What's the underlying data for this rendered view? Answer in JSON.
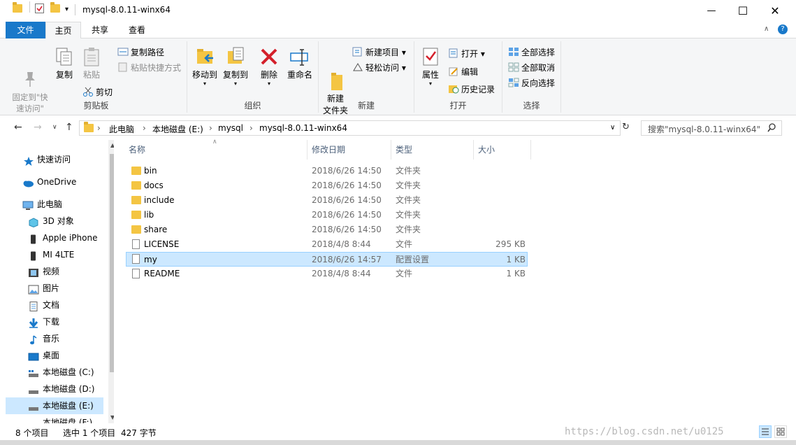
{
  "window": {
    "title": "mysql-8.0.11-winx64",
    "minimize": "—",
    "maximize": "☐",
    "close": "✕"
  },
  "ribbon_tabs": {
    "file": "文件",
    "home": "主页",
    "share": "共享",
    "view": "查看"
  },
  "ribbon": {
    "clipboard": {
      "pin": "固定到\"快\n速访问\"",
      "copy": "复制",
      "paste": "粘贴",
      "copy_path": "复制路径",
      "paste_shortcut": "粘贴快捷方式",
      "cut": "剪切",
      "label": "剪贴板"
    },
    "organize": {
      "move_to": "移动到",
      "copy_to": "复制到",
      "delete": "删除",
      "rename": "重命名",
      "label": "组织"
    },
    "new": {
      "new_folder": "新建\n文件夹",
      "new_item": "新建项目",
      "easy_access": "轻松访问",
      "label": "新建"
    },
    "open": {
      "properties": "属性",
      "open": "打开",
      "edit": "编辑",
      "history": "历史记录",
      "label": "打开"
    },
    "select": {
      "select_all": "全部选择",
      "select_none": "全部取消",
      "invert": "反向选择",
      "label": "选择"
    }
  },
  "address": {
    "crumbs": [
      "此电脑",
      "本地磁盘 (E:)",
      "mysql",
      "mysql-8.0.11-winx64"
    ],
    "search_placeholder": "搜索\"mysql-8.0.11-winx64\""
  },
  "nav": {
    "items": [
      {
        "label": "快速访问",
        "icon": "star-icon"
      },
      {
        "label": "OneDrive",
        "icon": "cloud-icon"
      },
      {
        "label": "此电脑",
        "icon": "computer-icon"
      },
      {
        "label": "3D 对象",
        "icon": "cube-icon"
      },
      {
        "label": "Apple iPhone",
        "icon": "phone-icon"
      },
      {
        "label": "MI 4LTE",
        "icon": "phone-icon"
      },
      {
        "label": "视频",
        "icon": "video-icon"
      },
      {
        "label": "图片",
        "icon": "picture-icon"
      },
      {
        "label": "文档",
        "icon": "document-icon"
      },
      {
        "label": "下载",
        "icon": "download-icon"
      },
      {
        "label": "音乐",
        "icon": "music-icon"
      },
      {
        "label": "桌面",
        "icon": "desktop-icon"
      },
      {
        "label": "本地磁盘 (C:)",
        "icon": "drive-icon"
      },
      {
        "label": "本地磁盘 (D:)",
        "icon": "drive-icon"
      },
      {
        "label": "本地磁盘 (E:)",
        "icon": "drive-icon"
      },
      {
        "label": "本地磁盘 (F:)",
        "icon": "drive-icon"
      }
    ]
  },
  "filelist": {
    "columns": {
      "name": "名称",
      "date": "修改日期",
      "type": "类型",
      "size": "大小"
    },
    "rows": [
      {
        "name": "bin",
        "date": "2018/6/26 14:50",
        "type": "文件夹",
        "size": "",
        "icon": "folder"
      },
      {
        "name": "docs",
        "date": "2018/6/26 14:50",
        "type": "文件夹",
        "size": "",
        "icon": "folder"
      },
      {
        "name": "include",
        "date": "2018/6/26 14:50",
        "type": "文件夹",
        "size": "",
        "icon": "folder"
      },
      {
        "name": "lib",
        "date": "2018/6/26 14:50",
        "type": "文件夹",
        "size": "",
        "icon": "folder"
      },
      {
        "name": "share",
        "date": "2018/6/26 14:50",
        "type": "文件夹",
        "size": "",
        "icon": "folder"
      },
      {
        "name": "LICENSE",
        "date": "2018/4/8 8:44",
        "type": "文件",
        "size": "295 KB",
        "icon": "doc"
      },
      {
        "name": "my",
        "date": "2018/6/26 14:57",
        "type": "配置设置",
        "size": "1 KB",
        "icon": "doc"
      },
      {
        "name": "README",
        "date": "2018/4/8 8:44",
        "type": "文件",
        "size": "1 KB",
        "icon": "doc"
      }
    ]
  },
  "status": {
    "count": "8 个项目",
    "selection": "选中 1 个项目",
    "size": "427 字节",
    "watermark": "https://blog.csdn.net/u0125"
  },
  "colors": {
    "accent": "#1979ca",
    "selection": "#cce8ff",
    "folder": "#f4c543"
  }
}
